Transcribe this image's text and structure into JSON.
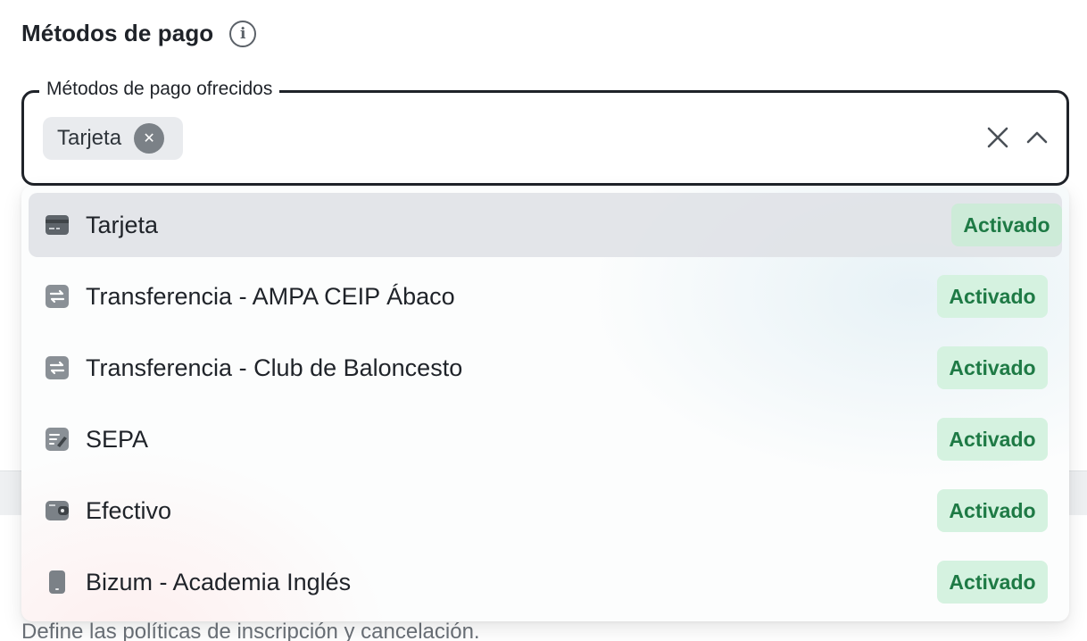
{
  "section": {
    "title": "Métodos de pago",
    "info_icon": "info-icon"
  },
  "field": {
    "legend": "Métodos de pago ofrecidos",
    "chips": [
      {
        "label": "Tarjeta",
        "remove_icon": "close-icon"
      }
    ],
    "clear_icon": "close-icon",
    "toggle_icon": "chevron-up-icon"
  },
  "options": [
    {
      "label": "Tarjeta",
      "icon": "credit-card-icon",
      "status": "Activado",
      "selected": true
    },
    {
      "label": "Transferencia - AMPA CEIP Ábaco",
      "icon": "transfer-icon",
      "status": "Activado",
      "selected": false
    },
    {
      "label": "Transferencia - Club de Baloncesto",
      "icon": "transfer-icon",
      "status": "Activado",
      "selected": false
    },
    {
      "label": "SEPA",
      "icon": "sign-document-icon",
      "status": "Activado",
      "selected": false
    },
    {
      "label": "Efectivo",
      "icon": "wallet-icon",
      "status": "Activado",
      "selected": false
    },
    {
      "label": "Bizum - Academia Inglés",
      "icon": "mobile-phone-icon",
      "status": "Activado",
      "selected": false
    }
  ],
  "footer": {
    "description": "Define las políticas de inscripción y cancelación."
  },
  "colors": {
    "badge_bg": "#d5f2e0",
    "badge_text": "#1e7a45",
    "border": "#1f2329"
  }
}
